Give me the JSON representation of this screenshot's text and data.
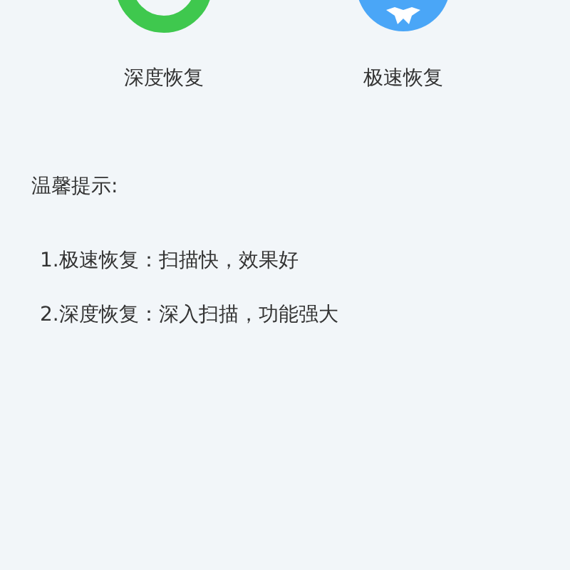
{
  "modes": [
    {
      "kind": "deep",
      "label": "深度恢复"
    },
    {
      "kind": "fast",
      "label": "极速恢复"
    }
  ],
  "tips": {
    "title": "温馨提示:",
    "items": [
      "1.极速恢复：扫描快，效果好",
      "2.深度恢复：深入扫描，功能强大"
    ]
  }
}
